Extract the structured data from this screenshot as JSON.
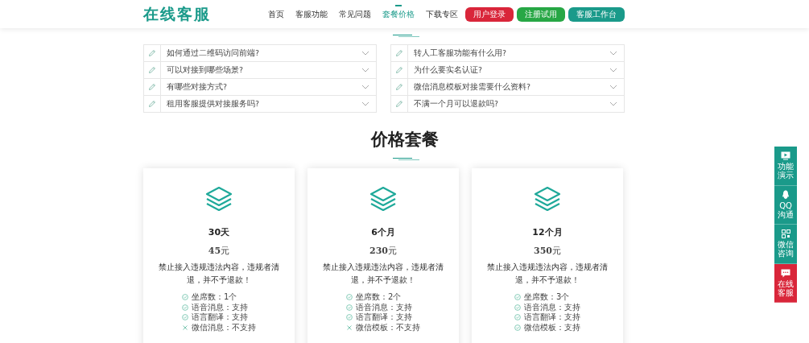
{
  "header": {
    "logo": "在线客服",
    "nav": [
      {
        "label": "首页",
        "selected": false
      },
      {
        "label": "客服功能",
        "selected": false
      },
      {
        "label": "常见问题",
        "selected": false
      },
      {
        "label": "套餐价格",
        "selected": true
      },
      {
        "label": "下载专区",
        "selected": false
      }
    ],
    "buttons": [
      {
        "label": "用户登录",
        "color": "#d9263a"
      },
      {
        "label": "注册试用",
        "color": "#27a745"
      },
      {
        "label": "客服工作台",
        "color": "#1a9a8a"
      }
    ]
  },
  "faq": [
    {
      "question": "如何通过二维码访问前端?"
    },
    {
      "question": "转人工客服功能有什么用?"
    },
    {
      "question": "可以对接到哪些场景?"
    },
    {
      "question": " 为什么要实名认证?"
    },
    {
      "question": "有哪些对接方式?"
    },
    {
      "question": "微信消息模板对接需要什么资料?"
    },
    {
      "question": "租用客服提供对接服务吗?"
    },
    {
      "question": "不满一个月可以退款吗?"
    }
  ],
  "pricing": {
    "title": "价格套餐",
    "plans": [
      {
        "name": "30天",
        "price": "45",
        "unit": "元",
        "note": "禁止接入违规违法内容，违规者清退，并不予退款！",
        "features": [
          {
            "text": "坐席数：1个",
            "supported": true
          },
          {
            "text": "语音消息：支持",
            "supported": true
          },
          {
            "text": "语言翻译：支持",
            "supported": true
          },
          {
            "text": "微信消息：不支持",
            "supported": false
          }
        ]
      },
      {
        "name": "6个月",
        "price": "230",
        "unit": "元",
        "note": "禁止接入违规违法内容，违规者清退，并不予退款！",
        "features": [
          {
            "text": "坐席数：2个",
            "supported": true
          },
          {
            "text": "语音消息：支持",
            "supported": true
          },
          {
            "text": "语言翻译：支持",
            "supported": true
          },
          {
            "text": "微信模板：不支持",
            "supported": false
          }
        ]
      },
      {
        "name": "12个月",
        "price": "350",
        "unit": "元",
        "note": "禁止接入违规违法内容，违规者清退，并不予退款！",
        "features": [
          {
            "text": "坐席数：3个",
            "supported": true
          },
          {
            "text": "语音消息：支持",
            "supported": true
          },
          {
            "text": "语言翻译：支持",
            "supported": true
          },
          {
            "text": "微信模板：支持",
            "supported": true
          }
        ]
      }
    ]
  },
  "side_panel": [
    {
      "kind": "video",
      "label": "功能演示",
      "color": "#1a9a8a"
    },
    {
      "kind": "qq",
      "label": "QQ沟通",
      "color": "#1a9a8a"
    },
    {
      "kind": "qrcode",
      "label": "微信咨询",
      "color": "#1a9a8a"
    },
    {
      "kind": "chat",
      "label": "在线客服",
      "color": "#d9263a"
    }
  ]
}
